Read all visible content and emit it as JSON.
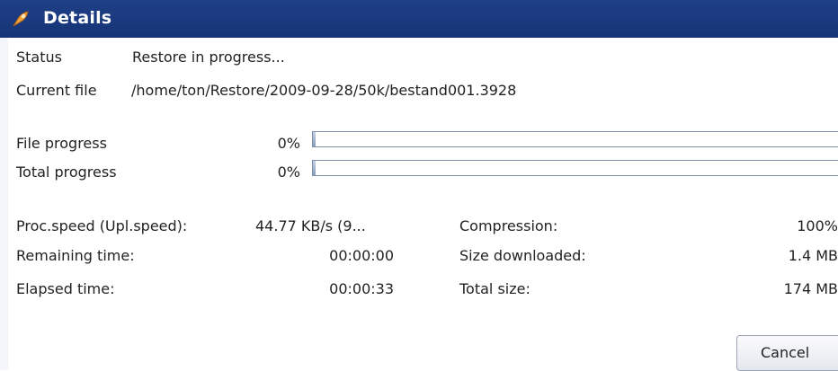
{
  "window": {
    "title": "Details",
    "icon": "restore-icon"
  },
  "status": {
    "label": "Status",
    "value": "Restore in progress..."
  },
  "current_file": {
    "label": "Current file",
    "value": "/home/ton/Restore/2009-09-28/50k/bestand001.3928"
  },
  "file_progress": {
    "label": "File progress",
    "percent_text": "0%",
    "value": 0
  },
  "total_progress": {
    "label": "Total progress",
    "percent_text": "0%",
    "value": 0
  },
  "stats": {
    "proc_speed": {
      "label": "Proc.speed (Upl.speed):",
      "value": "44.77 KB/s (9..."
    },
    "remaining_time": {
      "label": "Remaining time:",
      "value": "00:00:00"
    },
    "elapsed_time": {
      "label": "Elapsed time:",
      "value": "00:00:33"
    },
    "compression": {
      "label": "Compression:",
      "value": "100%"
    },
    "size_downloaded": {
      "label": "Size downloaded:",
      "value": "1.4 MB"
    },
    "total_size": {
      "label": "Total size:",
      "value": "174 MB"
    }
  },
  "buttons": {
    "cancel": "Cancel"
  },
  "colors": {
    "titlebar": "#1f3f86",
    "progress_fill": "#6b84b3",
    "progress_border": "#7f8ea7"
  }
}
